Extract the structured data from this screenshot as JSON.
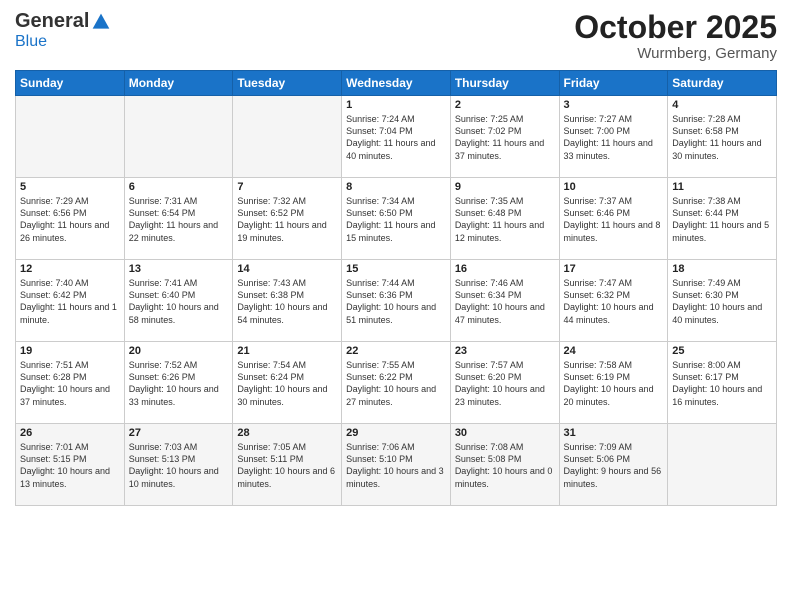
{
  "header": {
    "logo": {
      "general": "General",
      "blue": "Blue"
    },
    "title": "October 2025",
    "location": "Wurmberg, Germany"
  },
  "weekdays": [
    "Sunday",
    "Monday",
    "Tuesday",
    "Wednesday",
    "Thursday",
    "Friday",
    "Saturday"
  ],
  "weeks": [
    [
      {
        "day": "",
        "info": "",
        "empty": true
      },
      {
        "day": "",
        "info": "",
        "empty": true
      },
      {
        "day": "",
        "info": "",
        "empty": true
      },
      {
        "day": "1",
        "info": "Sunrise: 7:24 AM\nSunset: 7:04 PM\nDaylight: 11 hours and 40 minutes."
      },
      {
        "day": "2",
        "info": "Sunrise: 7:25 AM\nSunset: 7:02 PM\nDaylight: 11 hours and 37 minutes."
      },
      {
        "day": "3",
        "info": "Sunrise: 7:27 AM\nSunset: 7:00 PM\nDaylight: 11 hours and 33 minutes."
      },
      {
        "day": "4",
        "info": "Sunrise: 7:28 AM\nSunset: 6:58 PM\nDaylight: 11 hours and 30 minutes."
      }
    ],
    [
      {
        "day": "5",
        "info": "Sunrise: 7:29 AM\nSunset: 6:56 PM\nDaylight: 11 hours and 26 minutes."
      },
      {
        "day": "6",
        "info": "Sunrise: 7:31 AM\nSunset: 6:54 PM\nDaylight: 11 hours and 22 minutes."
      },
      {
        "day": "7",
        "info": "Sunrise: 7:32 AM\nSunset: 6:52 PM\nDaylight: 11 hours and 19 minutes."
      },
      {
        "day": "8",
        "info": "Sunrise: 7:34 AM\nSunset: 6:50 PM\nDaylight: 11 hours and 15 minutes."
      },
      {
        "day": "9",
        "info": "Sunrise: 7:35 AM\nSunset: 6:48 PM\nDaylight: 11 hours and 12 minutes."
      },
      {
        "day": "10",
        "info": "Sunrise: 7:37 AM\nSunset: 6:46 PM\nDaylight: 11 hours and 8 minutes."
      },
      {
        "day": "11",
        "info": "Sunrise: 7:38 AM\nSunset: 6:44 PM\nDaylight: 11 hours and 5 minutes."
      }
    ],
    [
      {
        "day": "12",
        "info": "Sunrise: 7:40 AM\nSunset: 6:42 PM\nDaylight: 11 hours and 1 minute."
      },
      {
        "day": "13",
        "info": "Sunrise: 7:41 AM\nSunset: 6:40 PM\nDaylight: 10 hours and 58 minutes."
      },
      {
        "day": "14",
        "info": "Sunrise: 7:43 AM\nSunset: 6:38 PM\nDaylight: 10 hours and 54 minutes."
      },
      {
        "day": "15",
        "info": "Sunrise: 7:44 AM\nSunset: 6:36 PM\nDaylight: 10 hours and 51 minutes."
      },
      {
        "day": "16",
        "info": "Sunrise: 7:46 AM\nSunset: 6:34 PM\nDaylight: 10 hours and 47 minutes."
      },
      {
        "day": "17",
        "info": "Sunrise: 7:47 AM\nSunset: 6:32 PM\nDaylight: 10 hours and 44 minutes."
      },
      {
        "day": "18",
        "info": "Sunrise: 7:49 AM\nSunset: 6:30 PM\nDaylight: 10 hours and 40 minutes."
      }
    ],
    [
      {
        "day": "19",
        "info": "Sunrise: 7:51 AM\nSunset: 6:28 PM\nDaylight: 10 hours and 37 minutes."
      },
      {
        "day": "20",
        "info": "Sunrise: 7:52 AM\nSunset: 6:26 PM\nDaylight: 10 hours and 33 minutes."
      },
      {
        "day": "21",
        "info": "Sunrise: 7:54 AM\nSunset: 6:24 PM\nDaylight: 10 hours and 30 minutes."
      },
      {
        "day": "22",
        "info": "Sunrise: 7:55 AM\nSunset: 6:22 PM\nDaylight: 10 hours and 27 minutes."
      },
      {
        "day": "23",
        "info": "Sunrise: 7:57 AM\nSunset: 6:20 PM\nDaylight: 10 hours and 23 minutes."
      },
      {
        "day": "24",
        "info": "Sunrise: 7:58 AM\nSunset: 6:19 PM\nDaylight: 10 hours and 20 minutes."
      },
      {
        "day": "25",
        "info": "Sunrise: 8:00 AM\nSunset: 6:17 PM\nDaylight: 10 hours and 16 minutes."
      }
    ],
    [
      {
        "day": "26",
        "info": "Sunrise: 7:01 AM\nSunset: 5:15 PM\nDaylight: 10 hours and 13 minutes.",
        "last": true
      },
      {
        "day": "27",
        "info": "Sunrise: 7:03 AM\nSunset: 5:13 PM\nDaylight: 10 hours and 10 minutes.",
        "last": true
      },
      {
        "day": "28",
        "info": "Sunrise: 7:05 AM\nSunset: 5:11 PM\nDaylight: 10 hours and 6 minutes.",
        "last": true
      },
      {
        "day": "29",
        "info": "Sunrise: 7:06 AM\nSunset: 5:10 PM\nDaylight: 10 hours and 3 minutes.",
        "last": true
      },
      {
        "day": "30",
        "info": "Sunrise: 7:08 AM\nSunset: 5:08 PM\nDaylight: 10 hours and 0 minutes.",
        "last": true
      },
      {
        "day": "31",
        "info": "Sunrise: 7:09 AM\nSunset: 5:06 PM\nDaylight: 9 hours and 56 minutes.",
        "last": true
      },
      {
        "day": "",
        "info": "",
        "empty": true,
        "last": true
      }
    ]
  ]
}
